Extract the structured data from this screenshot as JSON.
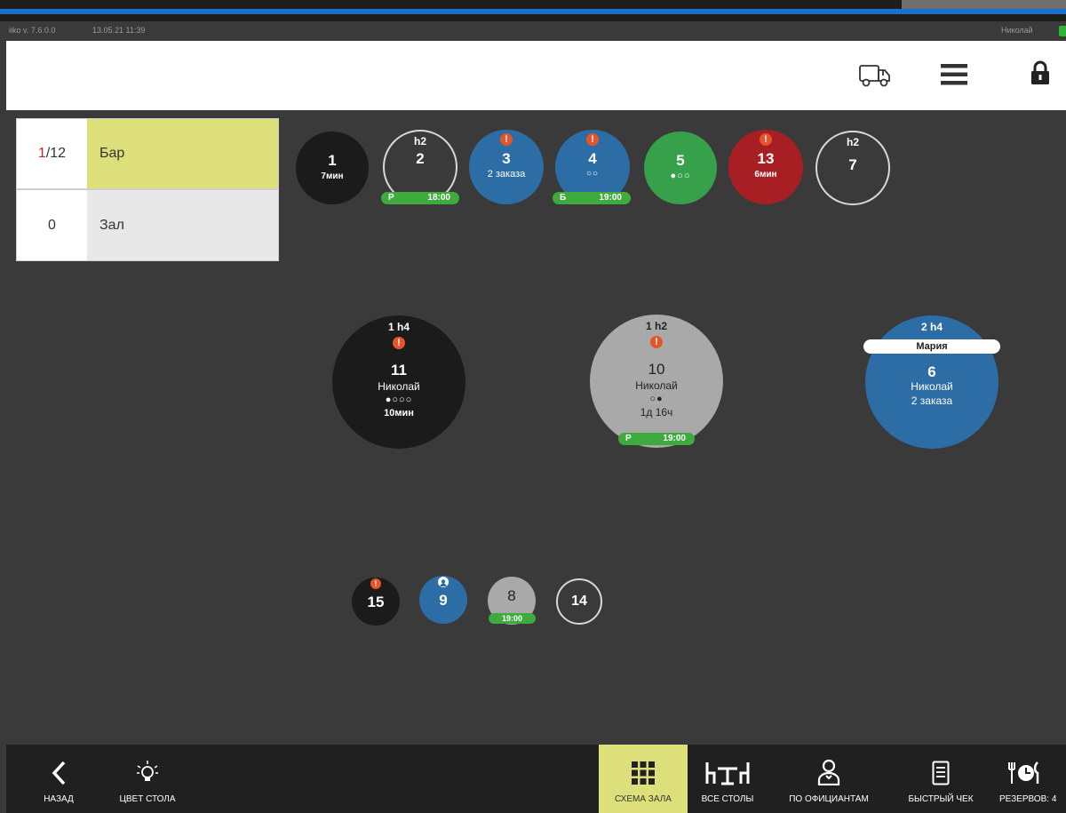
{
  "app": {
    "version": "iiko v. 7.6.0.0",
    "datetime": "13.05.21  11:39",
    "user": "Николай"
  },
  "header": {
    "icons": [
      "delivery-truck-icon",
      "menu-icon",
      "lock-icon"
    ]
  },
  "sections": [
    {
      "count_active": "1",
      "count_total": "/12",
      "name": "Бар",
      "selected": true
    },
    {
      "count": "0",
      "name": "Зал",
      "selected": false
    }
  ],
  "tables": {
    "t1": {
      "num": "1",
      "sub": "7мин"
    },
    "t2": {
      "num": "2",
      "seats": "h2",
      "reserve_key": "Р",
      "reserve_time": "18:00"
    },
    "t3": {
      "num": "3",
      "sub": "2 заказа"
    },
    "t4": {
      "num": "4",
      "dots": "○○",
      "reserve_key": "Б",
      "reserve_time": "19:00"
    },
    "t5": {
      "num": "5",
      "dots": "●○○"
    },
    "t13": {
      "num": "13",
      "sub": "6мин"
    },
    "t7": {
      "num": "7",
      "seats": "h2"
    },
    "t11": {
      "num": "11",
      "seats": "1 h4",
      "waiter": "Николай",
      "dots": "●○○○",
      "time": "10мин"
    },
    "t10": {
      "num": "10",
      "seats": "1 h2",
      "waiter": "Николай",
      "dots": "○●",
      "time": "1д 16ч",
      "reserve_key": "Р",
      "reserve_time": "19:00"
    },
    "t6": {
      "num": "6",
      "seats": "2 h4",
      "pill": "Мария",
      "waiter": "Николай",
      "sub": "2 заказа"
    },
    "t15": {
      "num": "15"
    },
    "t9": {
      "num": "9"
    },
    "t8": {
      "num": "8",
      "reserve_time": "19:00"
    },
    "t14": {
      "num": "14"
    }
  },
  "footer": {
    "back": "НАЗАД",
    "table_color": "ЦВЕТ СТОЛА",
    "hall_scheme": "СХЕМА ЗАЛА",
    "all_tables": "ВСЕ СТОЛЫ",
    "by_waiters": "ПО ОФИЦИАНТАМ",
    "quick_check": "БЫСТРЫЙ ЧЕК",
    "reservations": "РЕЗЕРВОВ: 4"
  },
  "colors": {
    "accent": "#dde07a",
    "table_blue": "#2c6da6",
    "table_green": "#37a04a",
    "table_red": "#a81f23",
    "alert": "#e5542a"
  }
}
